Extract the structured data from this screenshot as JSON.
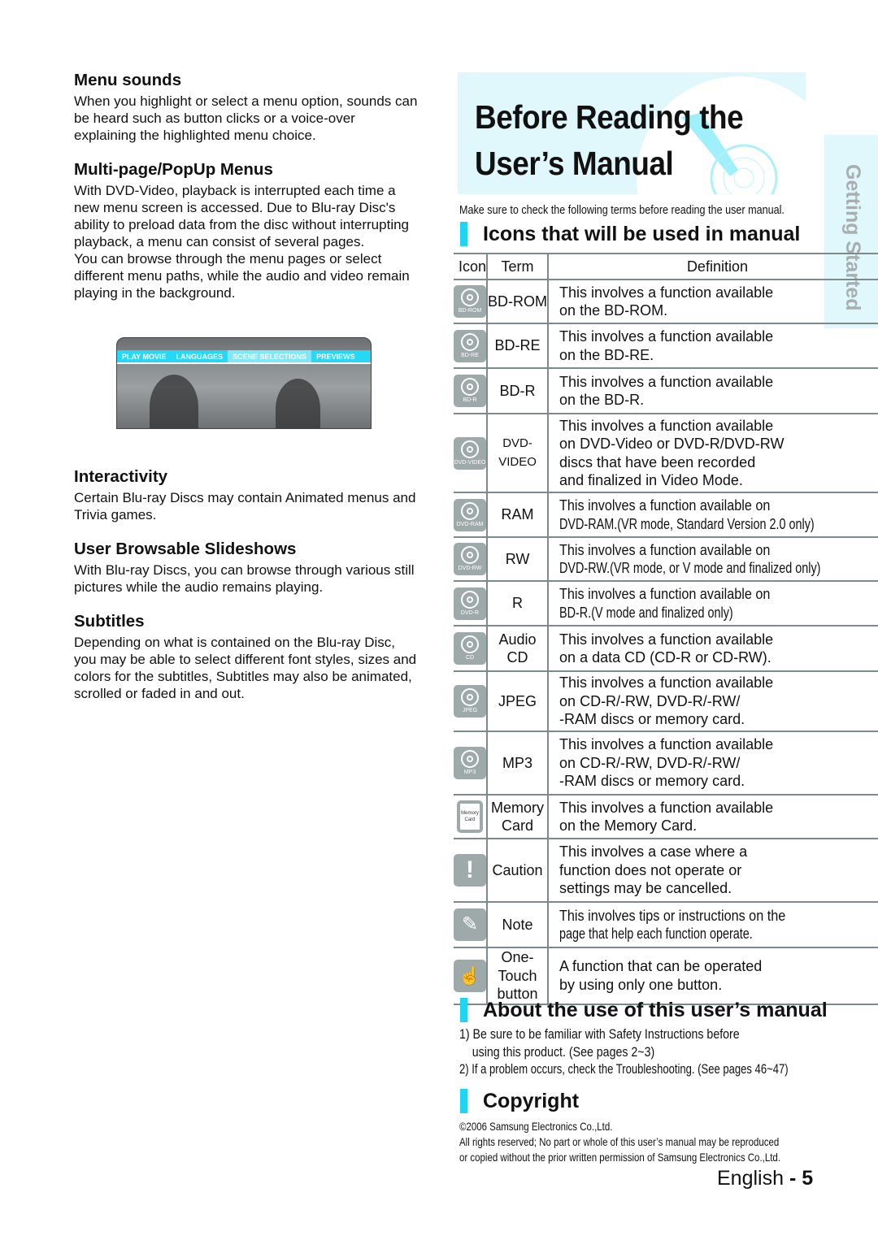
{
  "left": [
    {
      "heading": "Menu sounds",
      "text": "When you highlight or select a menu option, sounds can be heard such as button clicks or a voice-over explaining the highlighted menu choice."
    },
    {
      "heading": "Multi-page/PopUp Menus",
      "text": "With DVD-Video, playback is interrupted each time a new menu screen is accessed. Due to Blu-ray Disc's ability to preload data from the disc without interrupting playback, a menu can consist of several pages.",
      "text2": "You can browse through the menu pages or select different menu paths, while the audio and video remain playing in the background."
    },
    {
      "heading": "Interactivity",
      "text": "Certain Blu-ray Discs may contain Animated menus and Trivia games."
    },
    {
      "heading": "User Browsable Slideshows",
      "text": "With Blu-ray Discs, you can browse through various still pictures while the audio remains playing."
    },
    {
      "heading": "Subtitles",
      "text": "Depending on what is contained on the Blu-ray Disc, you may be able to select different font styles, sizes and colors for the subtitles, Subtitles may also be animated, scrolled or faded in and out."
    }
  ],
  "screenshot_menu": [
    "PLAY MOVIE",
    "LANGUAGES",
    "SCENE SELECTIONS",
    "PREVIEWS"
  ],
  "screenshot_selected": "SCENE SELECTIONS",
  "title_line1": "Before Reading the",
  "title_line2": "User’s Manual",
  "side_tab": "Getting Started",
  "intro": "Make sure to check the following terms before reading the user manual.",
  "icons_heading": "Icons that will be used in manual",
  "table_headers": [
    "Icon",
    "Term",
    "Definition"
  ],
  "rows": [
    {
      "icon": "bd-rom-disc-icon",
      "icon_label": "BD-ROM",
      "term": "BD-ROM",
      "lines": [
        "This involves a function available",
        "on the BD-ROM."
      ]
    },
    {
      "icon": "bd-re-disc-icon",
      "icon_label": "BD-RE",
      "term": "BD-RE",
      "lines": [
        "This involves a function available",
        "on the BD-RE."
      ]
    },
    {
      "icon": "bd-r-disc-icon",
      "icon_label": "BD-R",
      "term": "BD-R",
      "lines": [
        "This involves a function available",
        "on the BD-R."
      ]
    },
    {
      "icon": "dvd-video-disc-icon",
      "icon_label": "DVD-VIDEO",
      "term": "DVD-VIDEO",
      "lines": [
        "This involves a function available",
        "on DVD-Video or DVD-R/DVD-RW",
        "discs that have been recorded",
        "and finalized in Video Mode."
      ]
    },
    {
      "icon": "dvd-ram-disc-icon",
      "icon_label": "DVD-RAM",
      "term": "RAM",
      "lines": [
        "This involves a function available on",
        "DVD-RAM.(VR mode, Standard Version 2.0 only)"
      ],
      "condensed": true
    },
    {
      "icon": "dvd-rw-disc-icon",
      "icon_label": "DVD-RW",
      "term": "RW",
      "lines": [
        "This involves a function available  on",
        "DVD-RW.(VR mode, or V mode and finalized only)"
      ],
      "condensed": true
    },
    {
      "icon": "dvd-r-disc-icon",
      "icon_label": "DVD-R",
      "term": "R",
      "lines": [
        "This involves a function available on",
        "BD-R.(V mode and finalized only)"
      ],
      "condensed": true
    },
    {
      "icon": "cd-disc-icon",
      "icon_label": "CD",
      "term": "Audio CD",
      "lines": [
        "This involves a function available",
        "on a data CD (CD-R or CD-RW)."
      ]
    },
    {
      "icon": "jpeg-disc-icon",
      "icon_label": "JPEG",
      "term": "JPEG",
      "lines": [
        "This involves a function available",
        "on CD-R/-RW, DVD-R/-RW/",
        "-RAM discs or memory card."
      ]
    },
    {
      "icon": "mp3-disc-icon",
      "icon_label": "MP3",
      "term": "MP3",
      "lines": [
        "This involves a function available",
        "on CD-R/-RW, DVD-R/-RW/",
        "-RAM discs or memory card."
      ]
    },
    {
      "icon": "memory-card-icon",
      "icon_label": "Memory Card",
      "term": "Memory Card",
      "lines": [
        "This involves a function available",
        "on the Memory Card."
      ]
    },
    {
      "icon": "caution-icon",
      "icon_label": "",
      "term": "Caution",
      "lines": [
        "This involves a case where a",
        "function does not operate or",
        "settings may be cancelled."
      ]
    },
    {
      "icon": "note-pencil-icon",
      "icon_label": "",
      "term": "Note",
      "lines": [
        "This involves tips or instructions on the",
        "page that help each function operate."
      ],
      "condensed": true
    },
    {
      "icon": "one-touch-hand-icon",
      "icon_label": "",
      "term": "One-Touch button",
      "lines": [
        "A function that can be operated",
        "by using only one button."
      ]
    }
  ],
  "about_heading": "About the use of this user’s manual",
  "about": [
    "1) Be sure to be familiar with Safety Instructions before",
    "    using this product. (See pages 2~3)",
    "2) If a problem occurs, check the Troubleshooting. (See pages 46~47)"
  ],
  "copyright_heading": "Copyright",
  "copyright": [
    "©2006 Samsung Electronics Co.,Ltd.",
    "All rights reserved; No part or whole of this user’s manual may be reproduced",
    "or copied without the prior written permission of Samsung Electronics Co.,Ltd."
  ],
  "page": {
    "lang": "English",
    "sep": " - ",
    "num": "5"
  },
  "colors": {
    "accent": "#1fd5f2",
    "panel": "#e0f8fc",
    "icon_bg": "#9ea9aa"
  }
}
